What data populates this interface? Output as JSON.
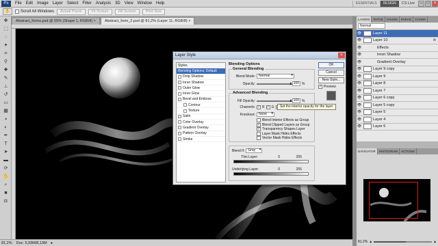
{
  "menubar": {
    "logo": "Ps",
    "items": [
      "File",
      "Edit",
      "Image",
      "Layer",
      "Select",
      "Filter",
      "Analysis",
      "3D",
      "View",
      "Window",
      "Help"
    ],
    "workspaces": [
      "ESSENTIALS",
      "DESIGN"
    ],
    "active_workspace": "DESIGN",
    "cs_live": "CS Live"
  },
  "options": {
    "scroll_all_windows": "Scroll All Windows",
    "buttons": [
      "Actual Pixels",
      "Fit Screen",
      "Fill Screen",
      "Print Size"
    ]
  },
  "tabs": [
    {
      "label": "Abstract_forms.psd @ 55% (Shape 1, RGB/8) ×",
      "active": false
    },
    {
      "label": "Abstract_form_2.psd @ 81,2% (Layer 11, RGB/8) ×",
      "active": true
    }
  ],
  "status": {
    "zoom": "81,2%",
    "doc": "Doc: 5,93M/8,13M"
  },
  "layers_panel": {
    "tabs": [
      "LAYERS",
      "PATHS",
      "CHANN",
      "PARAG",
      "CHARA"
    ],
    "blend_mode": "Normal",
    "layers": [
      {
        "name": "Layer 11",
        "selected": true,
        "fx": false,
        "indent": false
      },
      {
        "name": "Layer 10",
        "selected": false,
        "fx": true,
        "indent": false
      },
      {
        "name": "Effects",
        "selected": false,
        "fx": false,
        "indent": true
      },
      {
        "name": "Inner Shadow",
        "selected": false,
        "fx": false,
        "indent": true
      },
      {
        "name": "Gradient Overlay",
        "selected": false,
        "fx": false,
        "indent": true
      },
      {
        "name": "Layer 9 copy",
        "selected": false,
        "fx": false,
        "indent": false
      },
      {
        "name": "Layer 9",
        "selected": false,
        "fx": false,
        "indent": false
      },
      {
        "name": "Layer 8",
        "selected": false,
        "fx": false,
        "indent": false
      },
      {
        "name": "Layer 7",
        "selected": false,
        "fx": false,
        "indent": false
      },
      {
        "name": "Layer 6 copy",
        "selected": false,
        "fx": false,
        "indent": false
      },
      {
        "name": "Layer 5 copy",
        "selected": false,
        "fx": false,
        "indent": false
      },
      {
        "name": "Layer 5",
        "selected": false,
        "fx": false,
        "indent": false
      },
      {
        "name": "Layer 4",
        "selected": false,
        "fx": false,
        "indent": false
      },
      {
        "name": "Layer 6",
        "selected": false,
        "fx": false,
        "indent": false
      }
    ]
  },
  "navigator_panel": {
    "tabs": [
      "NAVIGATOR",
      "HISTOGRAM",
      "ACTIONS"
    ],
    "zoom": "81.2%"
  },
  "dialog": {
    "title": "Layer Style",
    "styles": [
      {
        "label": "Styles",
        "type": "header"
      },
      {
        "label": "Blending Options: Default",
        "type": "selected"
      },
      {
        "label": "Drop Shadow",
        "type": "check"
      },
      {
        "label": "Inner Shadow",
        "type": "check"
      },
      {
        "label": "Outer Glow",
        "type": "check"
      },
      {
        "label": "Inner Glow",
        "type": "check"
      },
      {
        "label": "Bevel and Emboss",
        "type": "check"
      },
      {
        "label": "Contour",
        "type": "indent"
      },
      {
        "label": "Texture",
        "type": "indent"
      },
      {
        "label": "Satin",
        "type": "check"
      },
      {
        "label": "Color Overlay",
        "type": "check"
      },
      {
        "label": "Gradient Overlay",
        "type": "check"
      },
      {
        "label": "Pattern Overlay",
        "type": "check"
      },
      {
        "label": "Stroke",
        "type": "check"
      }
    ],
    "blending_options": "Blending Options",
    "general_blending": "General Blending",
    "blend_mode_label": "Blend Mode:",
    "blend_mode_value": "Normal",
    "opacity_label": "Opacity:",
    "opacity_value": "100",
    "percent": "%",
    "advanced_blending": "Advanced Blending",
    "fill_opacity_label": "Fill Opacity:",
    "fill_opacity_value": "100",
    "channels_label": "Channels:",
    "channels": [
      "R",
      "G",
      "B"
    ],
    "knockout_label": "Knockout:",
    "knockout_value": "None",
    "checkboxes": [
      {
        "label": "Blend Interior Effects as Group",
        "checked": false
      },
      {
        "label": "Blend Clipped Layers as Group",
        "checked": true
      },
      {
        "label": "Transparency Shapes Layer",
        "checked": true
      },
      {
        "label": "Layer Mask Hides Effects",
        "checked": false
      },
      {
        "label": "Vector Mask Hides Effects",
        "checked": false
      }
    ],
    "blend_if_label": "Blend If:",
    "blend_if_value": "Gray",
    "this_layer_label": "This Layer:",
    "this_layer_low": "0",
    "this_layer_high": "255",
    "underlying_label": "Underlying Layer:",
    "underlying_low": "0",
    "underlying_high": "255",
    "buttons": {
      "ok": "OK",
      "cancel": "Cancel",
      "new_style": "New Style..."
    },
    "preview_label": "Preview"
  },
  "tooltip": "Set the interior opacity for the layer",
  "colors": {
    "selection_blue": "#3d6cb7",
    "canvas_black": "#000000",
    "navigator_frame_red": "#e01a1a"
  }
}
